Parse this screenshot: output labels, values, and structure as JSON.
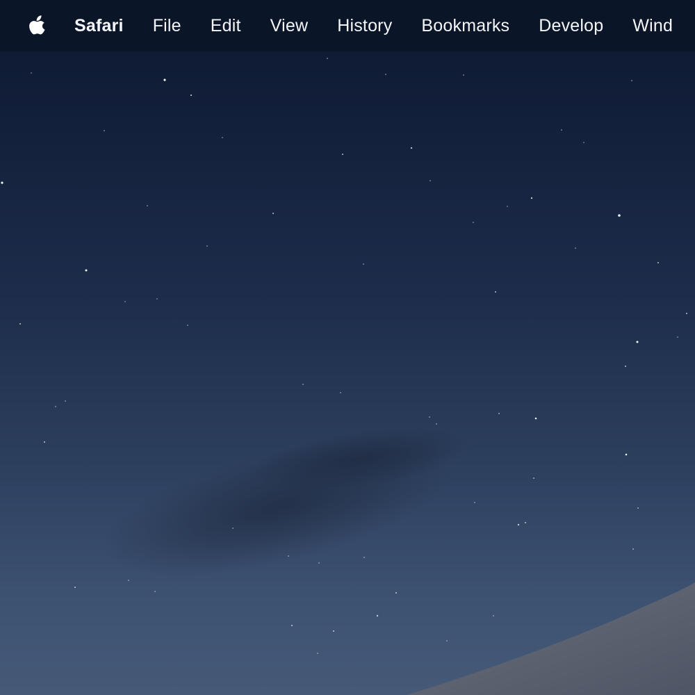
{
  "menubar": {
    "apple_menu_icon": "apple-logo",
    "app_name": "Safari",
    "items": [
      {
        "label": "File"
      },
      {
        "label": "Edit"
      },
      {
        "label": "View"
      },
      {
        "label": "History"
      },
      {
        "label": "Bookmarks"
      },
      {
        "label": "Develop"
      },
      {
        "label": "Wind"
      }
    ]
  },
  "desktop": {
    "wallpaper": "night-sky-dunes",
    "sky_color_top": "#0d1830",
    "sky_color_bottom": "#465a78",
    "dune_color": "#5d6371"
  }
}
